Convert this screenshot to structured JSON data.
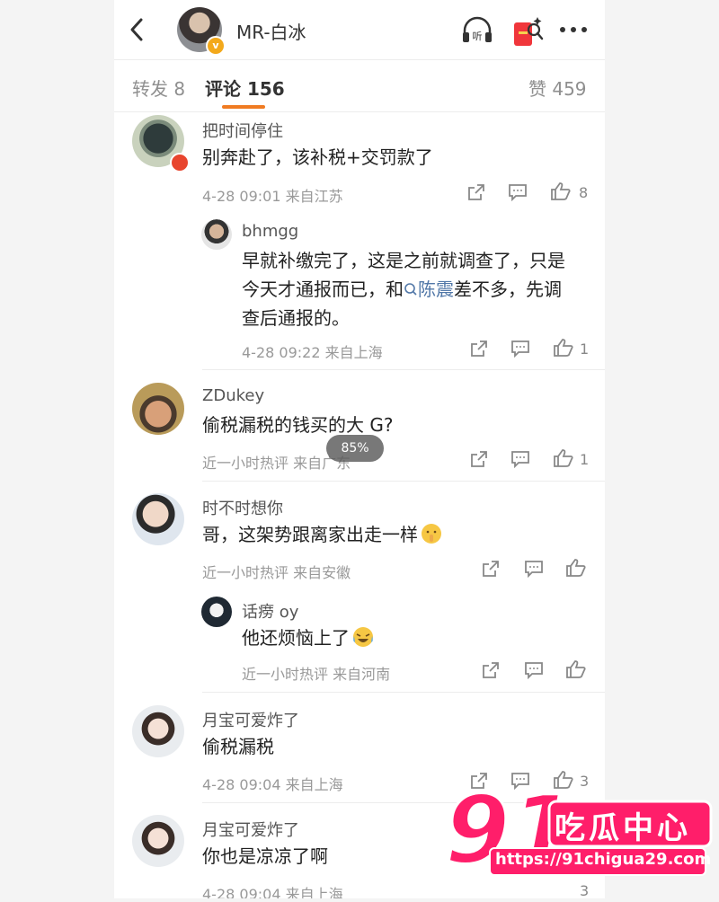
{
  "header": {
    "title": "MR-白冰",
    "verified": "v",
    "listen_label": "听"
  },
  "tabs": [
    {
      "label": "转发 8"
    },
    {
      "label": "评论 156"
    },
    {
      "label": "赞 459"
    }
  ],
  "comments": [
    {
      "name": "把时间停住",
      "text": "别奔赴了，该补税+交罚款了",
      "meta": "4-28 09:01 来自江苏",
      "likes": "8",
      "reply": {
        "name": "bhmgg",
        "text_parts": [
          "早就补缴完了，这是之前就调查了，只是",
          "今天才通报而已，和",
          "陈震",
          "差不多，先调",
          "查后通报的。"
        ],
        "meta": "4-28 09:22 来自上海",
        "likes": "1"
      }
    },
    {
      "name": "ZDukey",
      "text": "偷税漏税的钱买的大 G?",
      "meta": "近一小时热评 来自广东",
      "likes": "1"
    },
    {
      "name": "时不时想你",
      "text": "哥，这架势跟离家出走一样",
      "meta": "近一小时热评 来自安徽",
      "likes": "",
      "reply": {
        "name": "话痨 oy",
        "text": "他还烦恼上了",
        "meta": "近一小时热评 来自河南",
        "likes": ""
      }
    },
    {
      "name": "月宝可爱炸了",
      "text": "偷税漏税",
      "meta": "4-28 09:04 来自上海",
      "likes": "3"
    },
    {
      "name": "月宝可爱炸了",
      "text": "你也是凉凉了啊",
      "meta": "4-28 09:04 来自上海",
      "likes": "3"
    }
  ],
  "toast": "85%",
  "watermark": {
    "number": "91",
    "name": "吃瓜中心",
    "url": "https://91chigua29.com"
  },
  "colors": {
    "accent": "#f07b22",
    "link": "#5278a8",
    "watermark": "#ff1e6a"
  }
}
